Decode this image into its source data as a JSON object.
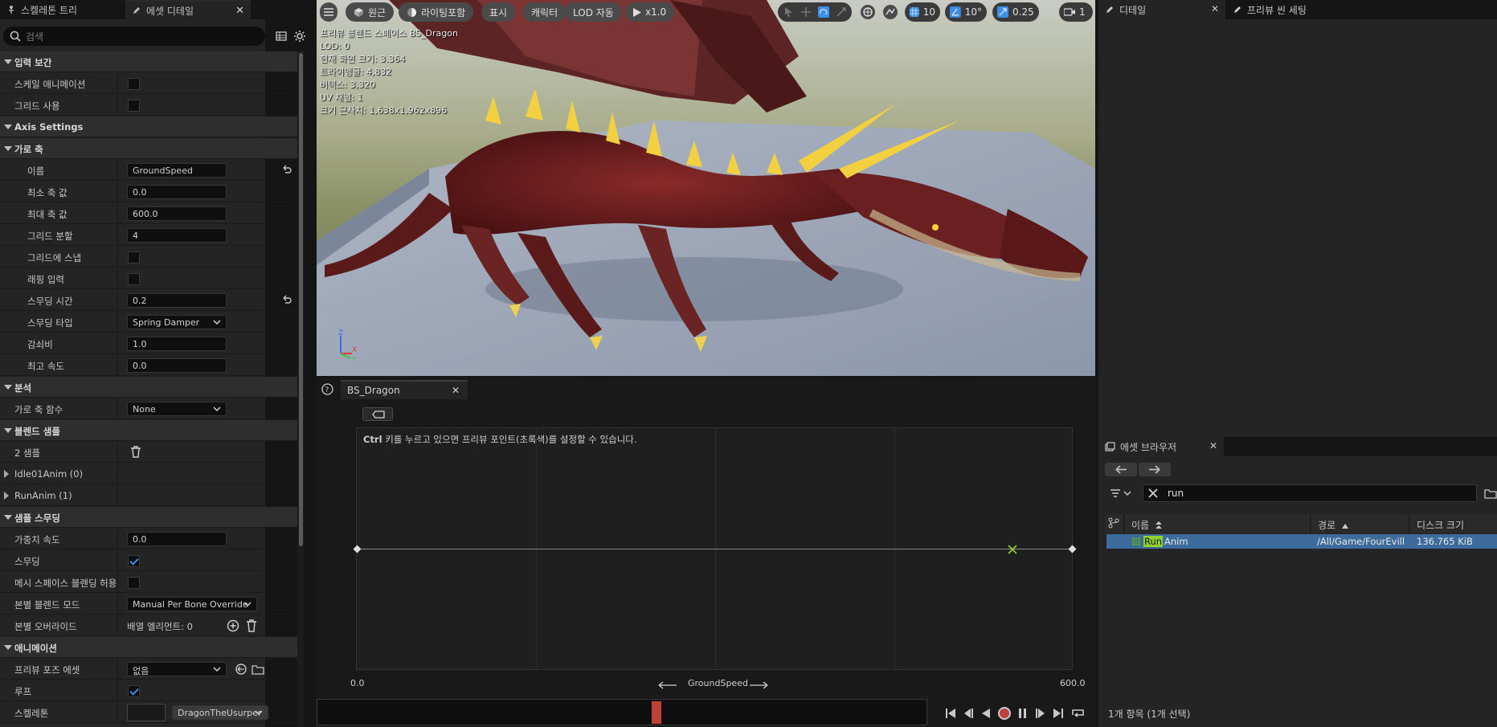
{
  "left_panel": {
    "tabs": [
      {
        "label": "스켈레톤 트리"
      },
      {
        "label": "에셋 디테일"
      }
    ],
    "search_placeholder": "검색",
    "rows": [
      {
        "type": "cat",
        "label": "입력 보간"
      },
      {
        "type": "check",
        "label": "스케일 애니메이션",
        "checked": false
      },
      {
        "type": "check",
        "label": "그리드 사용",
        "checked": false
      },
      {
        "type": "cat",
        "label": "Axis Settings"
      },
      {
        "type": "cat",
        "label": "가로 축"
      },
      {
        "type": "text",
        "label": "이름",
        "value": "GroundSpeed",
        "reset": true
      },
      {
        "type": "text",
        "label": "최소 축 값",
        "value": "0.0"
      },
      {
        "type": "text",
        "label": "최대 축 값",
        "value": "600.0"
      },
      {
        "type": "text",
        "label": "그리드 분할",
        "value": "4"
      },
      {
        "type": "check",
        "label": "그리드에 스냅",
        "checked": false
      },
      {
        "type": "check",
        "label": "래핑 입력",
        "checked": false
      },
      {
        "type": "text",
        "label": "스무딩 시간",
        "value": "0.2",
        "reset": true
      },
      {
        "type": "dropdown",
        "label": "스무딩 타입",
        "value": "Spring Damper"
      },
      {
        "type": "text",
        "label": "감쇠비",
        "value": "1.0"
      },
      {
        "type": "text",
        "label": "최고 속도",
        "value": "0.0"
      },
      {
        "type": "cat",
        "label": "분석"
      },
      {
        "type": "dropdown",
        "label": "가로 축 함수",
        "value": "None"
      },
      {
        "type": "cat",
        "label": "블렌드 샘플"
      },
      {
        "type": "trash",
        "label": "2 샘플"
      },
      {
        "type": "collapsed",
        "label": "Idle01Anim (0)"
      },
      {
        "type": "collapsed",
        "label": "RunAnim (1)"
      },
      {
        "type": "cat",
        "label": "샘플 스무딩"
      },
      {
        "type": "text",
        "label": "가중치 속도",
        "value": "0.0"
      },
      {
        "type": "check",
        "label": "스무딩",
        "checked": true
      },
      {
        "type": "check",
        "label": "메시 스페이스 블렌딩 허용",
        "checked": false
      },
      {
        "type": "dropdown",
        "label": "본별 블렌드 모드",
        "value": "Manual Per Bone Override"
      },
      {
        "type": "array",
        "label": "본별 오버라이드",
        "value": "배열 엘리먼트: 0"
      },
      {
        "type": "cat",
        "label": "애니메이션"
      },
      {
        "type": "dropdown-tools",
        "label": "프리뷰 포즈 에셋",
        "value": "없음"
      },
      {
        "type": "check",
        "label": "루프",
        "checked": true
      },
      {
        "type": "thumb",
        "label": "스켈레톤",
        "value": "DragonTheUsurper"
      }
    ]
  },
  "viewport": {
    "buttons": [
      {
        "label": "원근",
        "icon": "perspective-icon"
      },
      {
        "label": "라이팅포함",
        "icon": "lighting-icon"
      },
      {
        "label": "표시"
      },
      {
        "label": "캐릭터"
      },
      {
        "label": "LOD 자동"
      },
      {
        "label": "x1.0",
        "icon": "play-icon"
      }
    ],
    "right_values": {
      "grid": "10",
      "angle": "10°",
      "scale": "0.25",
      "camera": "1"
    },
    "stats": [
      "프리뷰 블렌드 스페이스 BS_Dragon",
      "LOD: 0",
      "현재 화면 크기: 3.364",
      "트라이앵글: 4,832",
      "버텍스: 3,320",
      "UV 채널: 1",
      "크기 근사치: 1,638x1,962x896"
    ]
  },
  "blend_editor": {
    "tab_label": "BS_Dragon",
    "hint_bold": "Ctrl",
    "hint_rest": " 키를 누르고 있으면 프리뷰 포인트(초록색)를 설정할 수 있습니다.",
    "axis_min": "0.0",
    "axis_max": "600.0",
    "axis_name": "GroundSpeed",
    "preview_value": 550
  },
  "right_panel": {
    "tabs": [
      {
        "label": "디테일"
      },
      {
        "label": "프리뷰 씬 세팅"
      }
    ],
    "asset_browser": {
      "title": "에셋 브라우저",
      "search_value": "run",
      "columns": [
        "이름",
        "경로",
        "디스크 크기"
      ],
      "row": {
        "name_highlight": "Run",
        "name_rest": "Anim",
        "path": "/All/Game/FourEvill",
        "size": "136.765 KiB"
      },
      "status": "1개 항목 (1개 선택)"
    }
  },
  "colors": {
    "accent": "#3b8fe6",
    "selection": "#3d6c9c",
    "playhead": "#c0403a",
    "preview_point": "#8fd12f"
  }
}
